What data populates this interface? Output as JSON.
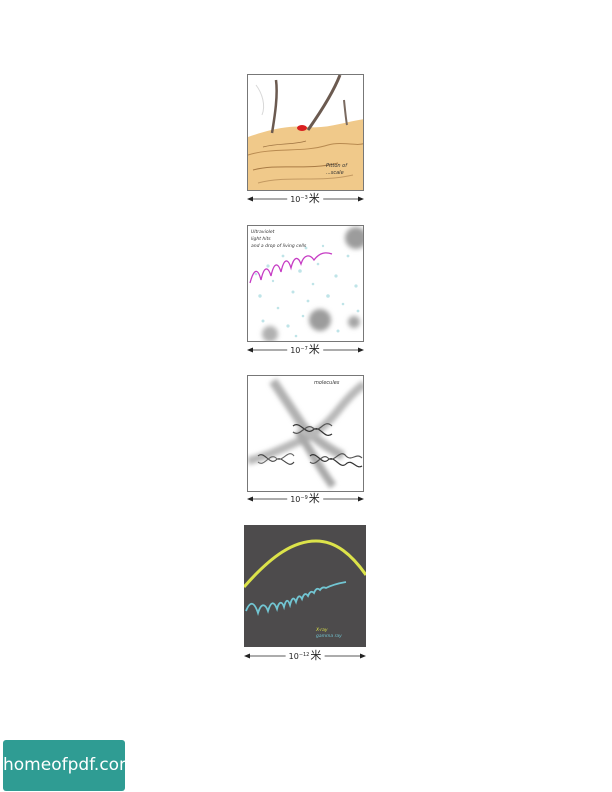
{
  "panels": [
    {
      "id": "skin",
      "annotation_lines": [
        "Pitton of",
        "...scale"
      ],
      "scale_label": {
        "base": "10",
        "exponent": "−3",
        "unit": "米"
      }
    },
    {
      "id": "cell",
      "annotation_lines": [
        "Ultraviolet",
        "light hits",
        "and a drop of living cells"
      ],
      "scale_label": {
        "base": "10",
        "exponent": "−7",
        "unit": "米"
      }
    },
    {
      "id": "dna",
      "annotation_lines": [
        "molecules"
      ],
      "scale_label": {
        "base": "10",
        "exponent": "−9",
        "unit": "米"
      }
    },
    {
      "id": "waves",
      "annotation_lines": [
        "X-ray",
        "gamma ray"
      ],
      "scale_label": {
        "base": "10",
        "exponent": "−12",
        "unit": "米"
      },
      "colors": {
        "background": "#4d4b4c",
        "long_wave": "#dce34a",
        "short_wave": "#72c6d3"
      }
    }
  ],
  "watermark": {
    "text": "homeofpdf.com",
    "color": "#2f9c93"
  }
}
